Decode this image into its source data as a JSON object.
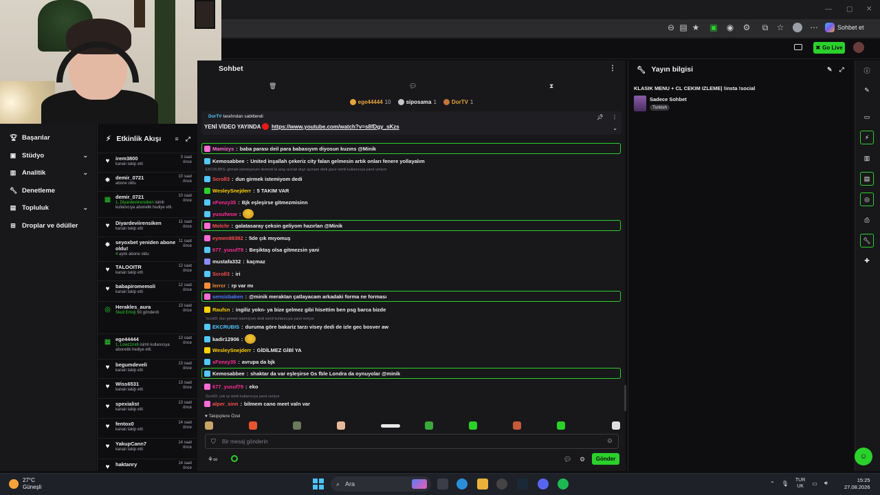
{
  "browser": {
    "copilot_label": "Sohbet et",
    "window_controls": [
      "—",
      "▢",
      "✕"
    ]
  },
  "topbar": {
    "go_live_label": "Go Live"
  },
  "leftnav": {
    "items": [
      {
        "label": "Başarılar",
        "icon": "trophy-icon",
        "chevron": false
      },
      {
        "label": "Stüdyo",
        "icon": "studio-icon",
        "chevron": true
      },
      {
        "label": "Analitik",
        "icon": "analytics-icon",
        "chevron": true
      },
      {
        "label": "Denetleme",
        "icon": "wrench-icon",
        "chevron": false
      },
      {
        "label": "Topluluk",
        "icon": "community-icon",
        "chevron": true
      },
      {
        "label": "Droplar ve ödüller",
        "icon": "gift-icon",
        "chevron": false
      }
    ]
  },
  "activity": {
    "title": "Etkinlik Akışı",
    "items": [
      {
        "name": "irem3800",
        "time": "3 saat önce",
        "desc": "kanalı takip etti",
        "icon": "heart-icon"
      },
      {
        "name": "demir_0721",
        "time": "10 saat önce",
        "desc": "abone oldu",
        "icon": "star-icon"
      },
      {
        "name": "demir_0721",
        "time": "10 saat önce",
        "desc_highlight": "1, Diyardeviirensiken",
        "desc": "isimli kullanıcıya abonelik hediye etti.",
        "icon": "gift-icon"
      },
      {
        "name": "Diyardeviirensiken",
        "time": "11 saat önce",
        "desc": "kanalı takip etti",
        "icon": "heart-icon"
      },
      {
        "name": "seyoxbet yeniden abone oldu!",
        "time": "11 saat önce",
        "desc_highlight": "4",
        "desc": "aylık abone oldu",
        "icon": "star-icon"
      },
      {
        "name": "TALOOITR",
        "time": "12 saat önce",
        "desc": "kanalı takip etti",
        "icon": "heart-icon"
      },
      {
        "name": "babapiromemoli",
        "time": "12 saat önce",
        "desc": "kanalı takip etti",
        "icon": "heart-icon"
      },
      {
        "name": "Herakles_aura",
        "time": "13 saat önce",
        "desc_highlight": "Skull Emoji",
        "desc": "50 gönderdi",
        "icon": "points-icon"
      },
      {
        "name": "ege44444",
        "time": "13 saat önce",
        "desc_highlight": "1, Lowz1nx6",
        "desc": "isimli kullanıcıya abonelik hediye etti.",
        "icon": "gift-icon"
      },
      {
        "name": "begumdeveli",
        "time": "13 saat önce",
        "desc": "kanalı takip etti",
        "icon": "heart-icon"
      },
      {
        "name": "Wiss6531",
        "time": "13 saat önce",
        "desc": "kanalı takip etti",
        "icon": "heart-icon"
      },
      {
        "name": "spexialist",
        "time": "13 saat önce",
        "desc": "kanalı takip etti",
        "icon": "heart-icon"
      },
      {
        "name": "fentox0",
        "time": "14 saat önce",
        "desc": "kanalı takip etti",
        "icon": "heart-icon"
      },
      {
        "name": "YakupCann7",
        "time": "14 saat önce",
        "desc": "kanalı takip etti",
        "icon": "heart-icon"
      },
      {
        "name": "haktanry",
        "time": "14 saat önce",
        "desc": "",
        "icon": "heart-icon"
      }
    ]
  },
  "chat": {
    "title": "Sohbet",
    "leaderboard": [
      {
        "name": "ege44444",
        "count": "10"
      },
      {
        "name": "siposama",
        "count": "1"
      },
      {
        "name": "DorTV",
        "count": "1"
      }
    ],
    "pinned": {
      "by_user": "DorTV",
      "by_text": "tarafından sabitlendi",
      "title": "YENİ VİDEO YAYINDA",
      "link": "https://www.youtube.com/watch?v=s8fDgy_sKzs"
    },
    "messages": [
      {
        "user": "Mamizys",
        "color": "#ff6ad5",
        "text": "baba parası deil para babasıyım diyosun kuzıns @Minik",
        "highlight": true
      },
      {
        "user": "Kemosabbee",
        "color": "#efeff1",
        "text": "United inşallah çekeriz city falan gelmesin artık onları fenere yollayalım",
        "highlight": false
      },
      {
        "reply": "EKCRUBIS: girmek istemiyorum demedi la aray acicak duyr açmam dedi gece isimli kullanıcıya yanıt veriyor"
      },
      {
        "user": "Scroll3",
        "color": "#ff4d4d",
        "text": "dun girmek istemiyom dedi",
        "highlight": false
      },
      {
        "user": "WesleySnejderr",
        "color": "#ffd000",
        "text": "5 TAKIM VAR",
        "highlight": false
      },
      {
        "user": "xFonzy35",
        "color": "#ff2d95",
        "text": "Bjk eşleşirse gitmezmisinn",
        "highlight": false
      },
      {
        "user": "yusufwsw",
        "color": "#ff2d95",
        "text": "",
        "highlight": false
      },
      {
        "user": "Molchr",
        "color": "#ff4d4d",
        "text": "galatasaray çeksin geliyom hazırlan @Minik",
        "highlight": true
      },
      {
        "user": "eymen88382",
        "color": "#ff4d4d",
        "text": "5de çık mıyomuş",
        "highlight": false
      },
      {
        "user": "677_yusuf79",
        "color": "#ff2d95",
        "text": "Beşiktaş olsa gitmezsin yani",
        "highlight": false
      },
      {
        "user": "mustafa332",
        "color": "#efeff1",
        "text": "kaçmaz",
        "highlight": false
      },
      {
        "user": "Scroll3",
        "color": "#ff4d4d",
        "text": "iri",
        "highlight": false
      },
      {
        "user": "lerrcr",
        "color": "#ff8c3a",
        "text": "rp var mı",
        "highlight": false
      },
      {
        "user": "sensizbaken",
        "color": "#4a7dff",
        "text": "@minik meraktan çatlayacam arkadaki forma ne forması",
        "highlight": true
      },
      {
        "user": "Raufsn",
        "color": "#ffd000",
        "text": "ingiliz yokn- ya bize gelmez gibi hisettim ben psg barca bizde",
        "highlight": false
      },
      {
        "reply": "Scroll3: dun girmek istemiyom dedi isimli kullanıcıya yanıt veriyor"
      },
      {
        "user": "EKCRUBIS",
        "color": "#53c7ff",
        "text": "duruma göre bakariz tarzı visey dedi de izle gec bosver aw",
        "highlight": false
      },
      {
        "user": "kadir12906",
        "color": "#efeff1",
        "text": "",
        "highlight": false
      },
      {
        "user": "WesleySnejderr",
        "color": "#ffd000",
        "text": "GİDİLMEZ GİBİ YA",
        "highlight": false
      },
      {
        "user": "xFonzy35",
        "color": "#ff2d95",
        "text": "avrupa da bjk",
        "highlight": false
      },
      {
        "user": "Kemosabbee",
        "color": "#efeff1",
        "text": "shaktar da var eşleşirse Gs fble Londra da oynuyolar @minik",
        "highlight": true
      },
      {
        "user": "677_yusuf79",
        "color": "#ff2d95",
        "text": "eko",
        "highlight": false
      },
      {
        "reply": "Scroll3: yok rp isimli kullanıcıya yanıt veriyor"
      },
      {
        "user": "alper_sinn",
        "color": "#ff4d4d",
        "text": "bilmem cano meet valn var",
        "highlight": false
      }
    ],
    "emote_label": "Takipçilere Özel",
    "input_placeholder": "Bir mesaj gönderin",
    "send_label": "Gönder"
  },
  "info": {
    "title": "Yayın bilgisi",
    "stream_title": "KLASIK MENU + CL CEKIM IZLEME| !insta !social",
    "category": "Sadece Sohbet",
    "language": "Turkish"
  },
  "taskbar": {
    "temperature": "27°C",
    "weather": "Güneşli",
    "search_label": "Ara",
    "lang_top": "TUR",
    "lang_bottom": "UK",
    "time": "15:25",
    "date": "27.08.2026"
  }
}
